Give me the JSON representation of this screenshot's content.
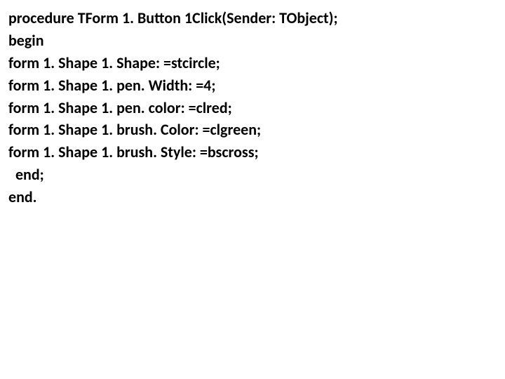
{
  "code": {
    "l1": "procedure TForm 1. Button 1Click(Sender: TObject);",
    "l2": "begin",
    "l3": "form 1. Shape 1. Shape: =stcircle;",
    "l4": "form 1. Shape 1. pen. Width: =4;",
    "l5": "form 1. Shape 1. pen. color: =clred;",
    "l6": "form 1. Shape 1. brush. Color: =clgreen;",
    "l7": "form 1. Shape 1. brush. Style: =bscross;",
    "l8": "  end;",
    "l9": "end."
  }
}
